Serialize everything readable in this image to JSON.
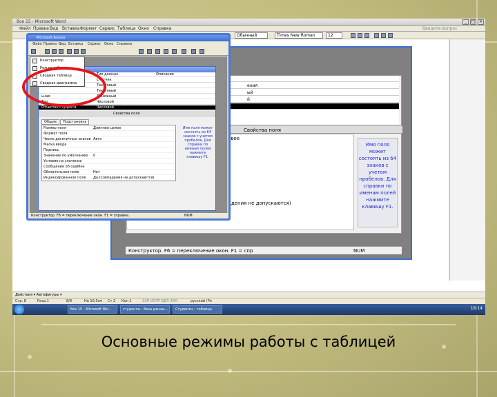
{
  "slide": {
    "caption": "Основные режимы работы с таблицей",
    "background_color": "#c9c38a",
    "highlight_color": "#e8141a"
  },
  "word": {
    "title": "Все 15 - Microsoft Word",
    "menu": [
      "Файл",
      "Правка",
      "Вид",
      "Вставка",
      "Формат",
      "Сервис",
      "Таблица",
      "Окно",
      "Справка"
    ],
    "style_combo": "Обычный",
    "font_combo": "Times New Roman",
    "size_combo": "12",
    "help_placeholder": "Введите вопрос",
    "draw_toolbar": "Действия ▾  Автофигуры ▾",
    "status": {
      "page": "Стр. 8",
      "section": "Разд 1",
      "pages": "8/8",
      "position": "На 16,5см",
      "line": "Ст 2",
      "col": "Кол 1",
      "modes": "ЗАП  ИСПР  ВДЛ  ЗАМ",
      "lang": "русский (Ро"
    }
  },
  "access_outer": {
    "grid_rows": [
      "",
      "ения",
      "ый",
      "й",
      ""
    ],
    "section_title": "Свойства поля",
    "prop_value": "овое",
    "prop_note": "ддения не допускаются)",
    "hint": "Имя поля может состоять из 64 знаков с учетом пробелов. Для справки по именам полей нажмите клавишу F1.",
    "status_text": "Конструктор. F6 = переключение окон. F1 = спр",
    "num": "NUM"
  },
  "access_inner": {
    "title": "Microsoft Access",
    "menu": [
      "Файл",
      "Правка",
      "Вид",
      "Вставка",
      "Сервис",
      "Окно",
      "Справка"
    ],
    "view_dropdown": [
      "Конструктор",
      "Режим таблицы",
      "Сводная таблица",
      "Сводная диаграмма"
    ],
    "grid_headers": [
      "Тип данных",
      "Описание"
    ],
    "grid_rows": [
      {
        "name": "",
        "type": "Счетчик"
      },
      {
        "name": "",
        "type": "Текстовый"
      },
      {
        "name": "",
        "type": "Текстовый"
      },
      {
        "name": "ьная",
        "type": "Денежный"
      },
      {
        "name": "Тип",
        "type": "Числовой"
      },
      {
        "name": "Отчество студента",
        "type": "Числовой"
      }
    ],
    "section_title": "Свойства поля",
    "tabs": [
      "Общие",
      "Подстановка"
    ],
    "props": [
      {
        "k": "Размер поля",
        "v": "Длинное целое"
      },
      {
        "k": "Формат поля",
        "v": ""
      },
      {
        "k": "Число десятичных знаков",
        "v": "Авто"
      },
      {
        "k": "Маска ввода",
        "v": ""
      },
      {
        "k": "Подпись",
        "v": ""
      },
      {
        "k": "Значение по умолчанию",
        "v": "0"
      },
      {
        "k": "Условие на значение",
        "v": ""
      },
      {
        "k": "Сообщение об ошибке",
        "v": ""
      },
      {
        "k": "Обязательное поле",
        "v": "Нет"
      },
      {
        "k": "Индексированное поле",
        "v": "Да (Совпадения не допускаются)"
      }
    ],
    "hint": "Имя поля может состоять из 64 знаков с учетом пробелов. Для справки по именам полей нажмите клавишу F1.",
    "status_text": "Конструктор. F6 = переключение окон. F1 = справка.",
    "num": "NUM"
  },
  "taskbar": {
    "tasks": [
      "Все 15 - Microsoft Wo...",
      "студенты : база данны...",
      "Студенты : таблица"
    ],
    "clock": "18:14"
  }
}
